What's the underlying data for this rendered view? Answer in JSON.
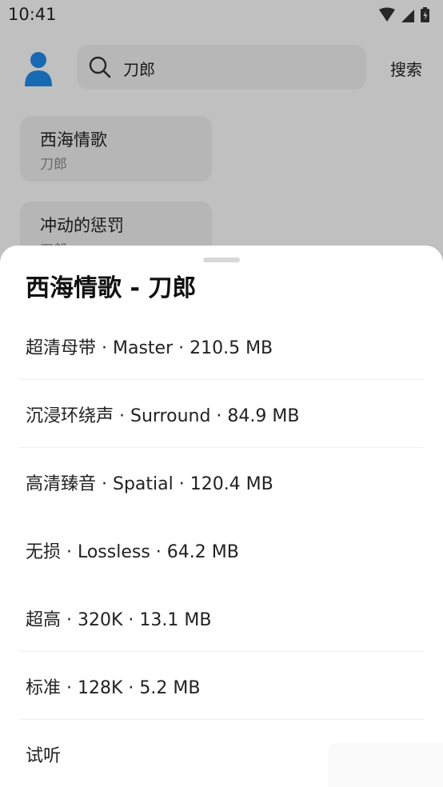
{
  "status": {
    "time": "10:41"
  },
  "search": {
    "query": "刀郎",
    "button_label": "搜索"
  },
  "results": [
    {
      "title": "西海情歌",
      "artist": "刀郎"
    },
    {
      "title": "冲动的惩罚",
      "artist": "刀郎"
    }
  ],
  "sheet": {
    "title": "西海情歌 - 刀郎",
    "options": [
      "超清母带 · Master · 210.5 MB",
      "沉浸环绕声 · Surround · 84.9 MB",
      "高清臻音 · Spatial · 120.4 MB",
      "无损 · Lossless · 64.2 MB",
      "超高 · 320K · 13.1 MB",
      "标准 · 128K · 5.2 MB",
      "试听"
    ]
  },
  "colors": {
    "accent": "#1e88e5",
    "scrim": "#000000",
    "sheet": "#ffffff"
  },
  "icons": [
    "wifi-icon",
    "signal-icon",
    "battery-icon",
    "user-avatar-icon",
    "search-icon"
  ]
}
